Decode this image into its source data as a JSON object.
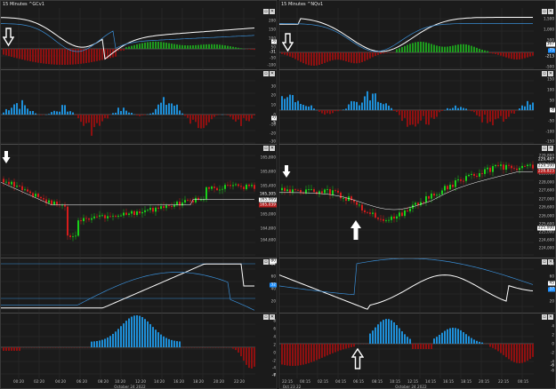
{
  "left_chart": {
    "title": "15 Minutes ^GCv1",
    "pane_controls": [
      "▫",
      "✕"
    ],
    "panes": [
      {
        "id": "osc1",
        "ticks": [
          "200",
          "150",
          "100",
          "50",
          "-50",
          "-100"
        ],
        "tags": [
          "-6",
          "-31"
        ]
      },
      {
        "id": "histo1",
        "ticks": [
          "30",
          "20",
          "10",
          "0",
          "-10",
          "-20",
          "-30"
        ],
        "tags": [
          "-0",
          "-5"
        ]
      },
      {
        "id": "price",
        "ticks": [
          "165,800",
          "165,600",
          "165,400",
          "165,200",
          "165,000",
          "164,800",
          "164,600",
          "164,400"
        ],
        "tags": [
          "165,305",
          "165,069",
          "165,039"
        ]
      },
      {
        "id": "osc2",
        "ticks": [
          "80",
          "60",
          "40",
          "20"
        ],
        "tags": [
          "80",
          "32"
        ]
      },
      {
        "id": "histo2",
        "ticks": [
          "8",
          "6",
          "4",
          "2",
          "0",
          "-2",
          "-4",
          "-6"
        ],
        "tags": [
          "-7"
        ]
      }
    ],
    "time_labels": [
      "00:20",
      "02:20",
      "04:20",
      "06:20",
      "08:20",
      "10:20",
      "12:20",
      "14:20",
      "16:20",
      "18:20",
      "20:20",
      "22:20"
    ],
    "date_label": "October 24 2022"
  },
  "right_chart": {
    "title": "15 Minutes ^NQv1",
    "pane_controls": [
      "▫",
      "✕"
    ],
    "panes": [
      {
        "id": "osc1",
        "ticks": [
          "1,500",
          "1,000",
          "500",
          "-500"
        ],
        "tags": [
          "367",
          "75",
          "-213"
        ]
      },
      {
        "id": "histo1",
        "ticks": [
          "150",
          "100",
          "50",
          "-50",
          "-100",
          "-150"
        ],
        "tags": [
          "-8"
        ]
      },
      {
        "id": "price",
        "ticks": [
          "229,800",
          "229,100",
          "228,600",
          "228,000",
          "227,600",
          "227,000",
          "226,600",
          "226,000",
          "225,600",
          "225,000",
          "224,600",
          "224,000"
        ],
        "tags": [
          "229,487",
          "229,100",
          "228,823",
          "225,000"
        ]
      },
      {
        "id": "osc2",
        "ticks": [
          "80",
          "60",
          "40",
          "20"
        ],
        "tags": [
          "45",
          "37"
        ]
      },
      {
        "id": "histo2",
        "ticks": [
          "4",
          "2",
          "0",
          "-2",
          "-4",
          "-6"
        ],
        "tags": [
          "-6"
        ]
      }
    ],
    "time_labels": [
      "22:15",
      "00:15",
      "02:15",
      "04:15",
      "06:15",
      "08:15",
      "10:15",
      "12:15",
      "14:15",
      "16:15",
      "18:15",
      "20:15",
      "22:15",
      "00:15"
    ],
    "date_labels": [
      "Oct 23 22",
      "October 24 2022"
    ]
  },
  "colors": {
    "up": "#19d119",
    "down": "#d61c1c",
    "histo_pos_blue": "#1e8fd8",
    "histo_neg_red": "#8f1010",
    "histo_pos_green": "#1e9a1e",
    "line_white": "#ffffff",
    "line_blue": "#3a8fd8",
    "grid": "#2e2e2e",
    "pane_border": "#4a4a4a"
  },
  "icons": {
    "hollow_down_arrow": "arrow-down-outline-icon",
    "solid_down_arrow": "arrow-down-solid-icon",
    "solid_up_arrow": "arrow-up-solid-icon",
    "hollow_up_arrow": "arrow-up-outline-icon"
  }
}
